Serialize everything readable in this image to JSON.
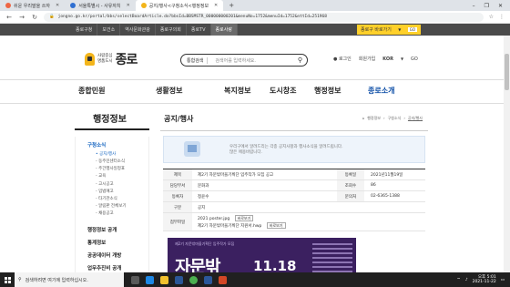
{
  "browser": {
    "tabs": [
      {
        "label": "쉬운 우리말을 쓰자",
        "active": false
      },
      {
        "label": "서울특별시 - 사유자치",
        "active": false
      },
      {
        "label": "공지/행사<구청소식<행정정보",
        "active": true
      }
    ],
    "new_tab": "+",
    "url": "jongno.go.kr/portal/bbs/selectBoardArticle.do?bbsId=BBSMSTR_000000000201&menuNo=1752&menuId=1752&nttId=251968",
    "window_controls": [
      "–",
      "❐",
      "✕"
    ]
  },
  "site_top": {
    "tabs": [
      "종로구청",
      "보건소",
      "역사문화관광",
      "종로구의회",
      "종로TV",
      "종로사랑"
    ],
    "active_index": 5,
    "quick_select": {
      "label": "종로구 바로가기",
      "go": "GO"
    }
  },
  "header": {
    "logo_sub_1": "사람중심",
    "logo_sub_2": "명품도시",
    "logo_main": "종로",
    "search_category": "통합검색",
    "search_placeholder": "검색어를 입력하세요.",
    "login": "로그인",
    "signup": "회원가입",
    "lang": "KOR",
    "lang_go": "GO"
  },
  "gnb": {
    "items": [
      "종합민원",
      "생활정보",
      "복지정보",
      "도시창조",
      "행정정보",
      "종로소개"
    ],
    "active_index": 5
  },
  "lnb": {
    "title": "행정정보",
    "section": "구청소식",
    "subs": [
      "공지/행사",
      "동주민센터소식",
      "주간행사일정표",
      "교육",
      "고시공고",
      "입법예고",
      "타기관소식",
      "알림판 전체보기",
      "채용공고"
    ],
    "active_sub": 0,
    "mains": [
      "행정정보 공개",
      "통계정보",
      "공공데이터 개방",
      "업무추진비 공개"
    ]
  },
  "content": {
    "title": "공지/행사",
    "breadcrumb": [
      "행정정보",
      "구청소식",
      "공지/행사"
    ],
    "notice_line1": "우리구에서 알려드리는 각종 공지사항과 행사소식을 알려드립니다.",
    "notice_line2": "많은 애용바랍니다.",
    "rows": {
      "subject_label": "제목",
      "subject": "제2기 자문밖마을기획단 입주작가 모집 공고",
      "regdate_label": "등록일",
      "regdate": "2021년11월19일",
      "dept_label": "담당부서",
      "dept": "문화과",
      "views_label": "조회수",
      "views": "86",
      "author_label": "등록자",
      "author": "정윤수",
      "phone_label": "문의처",
      "phone": "02-6365-1388",
      "type_label": "구분",
      "type": "공지",
      "attach_label": "첨부파일",
      "files": [
        {
          "name": "2021 poster.jpg",
          "action": "바로보기"
        },
        {
          "name": "제2기 자문밖마을기획단 지원서.hwp",
          "action": "바로보기"
        }
      ]
    },
    "poster": {
      "tag": "제2기 자문밖마을기획단 입주작가 모집",
      "big": "자문밖",
      "date": "11.18"
    }
  },
  "taskbar": {
    "search_placeholder": "검색하려면 여기에 입력하십시오.",
    "time": "오후 5:01",
    "date": "2021-11-22"
  },
  "colors": {
    "accent_blue": "#1565c0",
    "sitetop_bg": "#4a4a4a",
    "yellow": "#ffd02a",
    "poster_bg": "#3b2060"
  }
}
